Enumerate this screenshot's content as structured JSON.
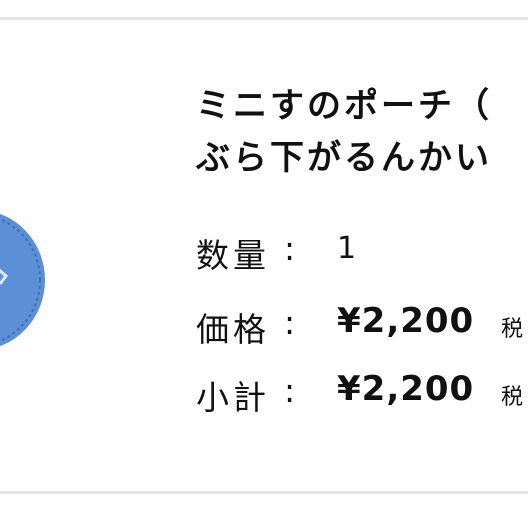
{
  "product": {
    "title_line1": "ミニすのポーチ（",
    "title_line2": "ぶら下がるんかい"
  },
  "quantity": {
    "label": "数量",
    "colon": ":",
    "value": "1"
  },
  "price": {
    "label": "価格",
    "colon": ":",
    "amount": "¥2,200",
    "tax_note": "税"
  },
  "subtotal": {
    "label": "小計",
    "colon": ":",
    "amount": "¥2,200",
    "tax_note": "税"
  },
  "colors": {
    "pouch_blue": "#5b8fd6",
    "divider": "#e6e6e6"
  }
}
